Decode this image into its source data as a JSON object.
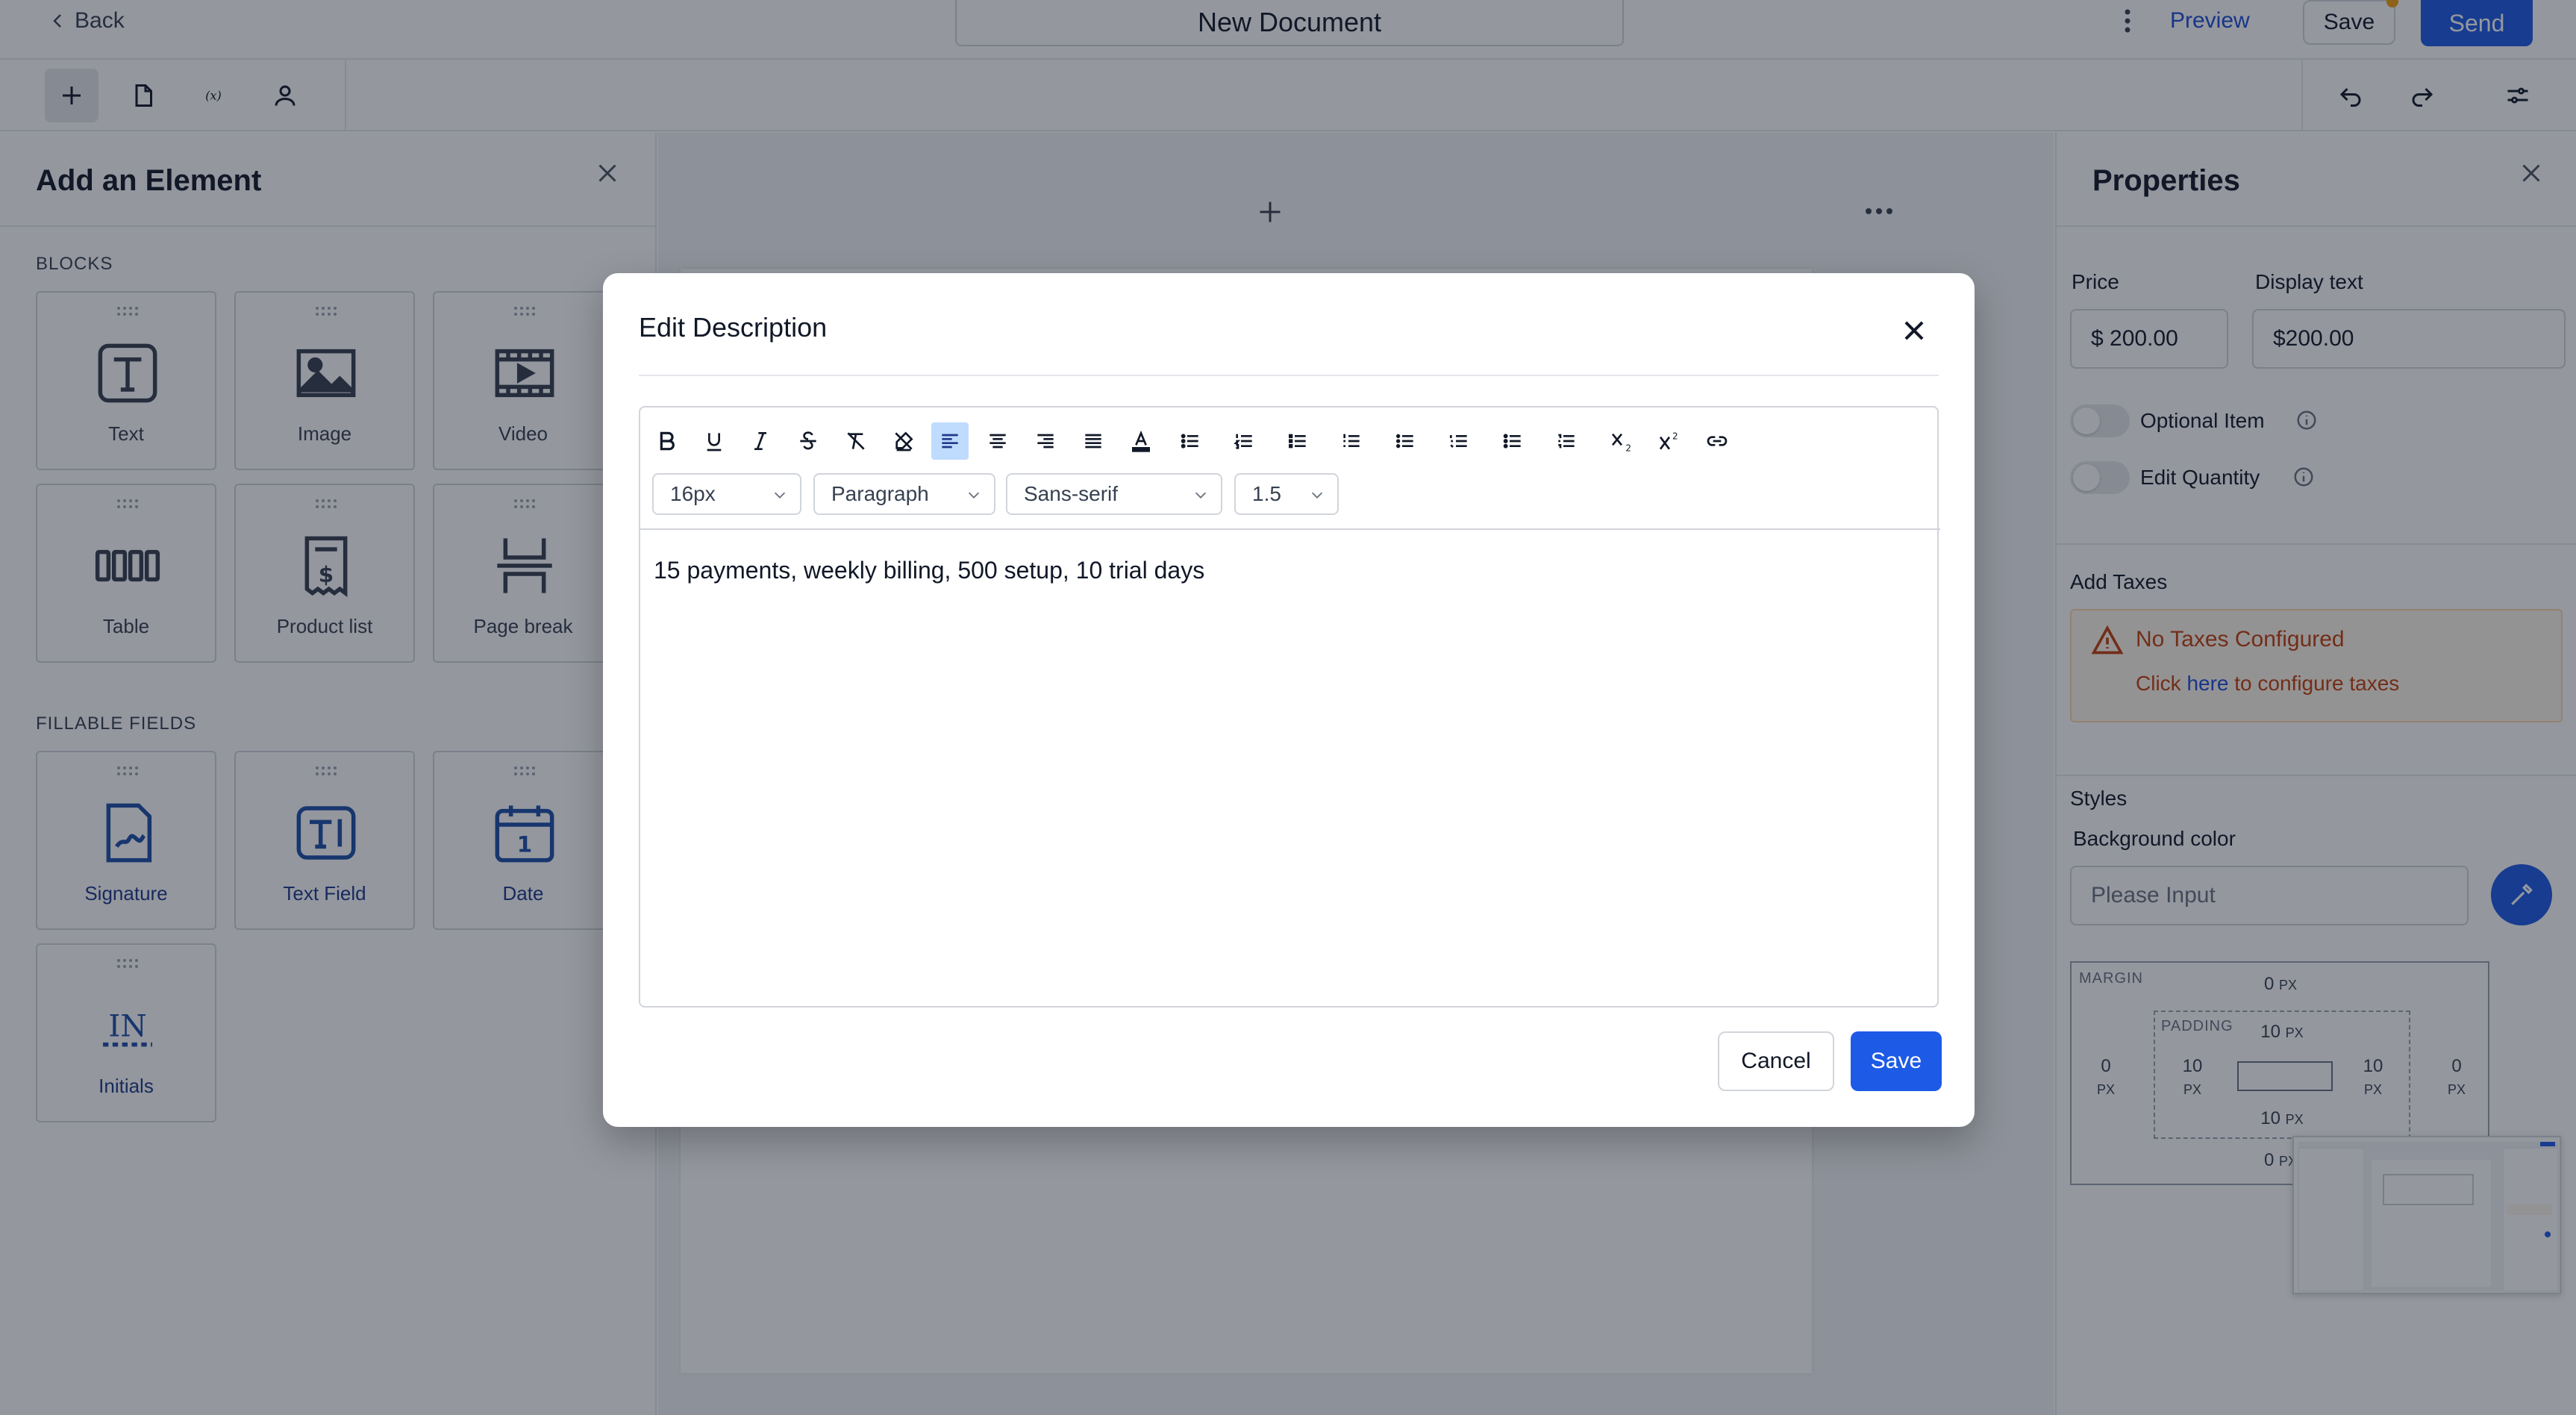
{
  "header": {
    "back_label": "Back",
    "document_title": "New Document",
    "preview_label": "Preview",
    "save_label": "Save",
    "send_label": "Send"
  },
  "left_panel": {
    "title": "Add an Element",
    "blocks_label": "BLOCKS",
    "blocks": [
      {
        "label": "Text",
        "icon": "text-icon"
      },
      {
        "label": "Image",
        "icon": "image-icon"
      },
      {
        "label": "Video",
        "icon": "video-icon"
      },
      {
        "label": "Table",
        "icon": "table-icon"
      },
      {
        "label": "Product list",
        "icon": "product-list-icon"
      },
      {
        "label": "Page break",
        "icon": "page-break-icon"
      }
    ],
    "fillable_label": "FILLABLE FIELDS",
    "fillable": [
      {
        "label": "Signature",
        "icon": "signature-icon"
      },
      {
        "label": "Text Field",
        "icon": "text-field-icon"
      },
      {
        "label": "Date",
        "icon": "date-icon",
        "glyph": "1"
      },
      {
        "label": "Initials",
        "icon": "initials-icon",
        "glyph": "IN"
      }
    ]
  },
  "right_panel": {
    "title": "Properties",
    "price_label": "Price",
    "price_value": "$ 200.00",
    "display_text_label": "Display text",
    "display_text_value": "$200.00",
    "optional_item_label": "Optional Item",
    "edit_quantity_label": "Edit Quantity",
    "add_taxes_label": "Add Taxes",
    "tax_warning_title": "No Taxes Configured",
    "tax_click": "Click ",
    "tax_here": "here",
    "tax_rest": " to configure taxes",
    "styles_label": "Styles",
    "bg_color_label": "Background color",
    "bg_color_placeholder": "Please Input",
    "box_model": {
      "margin_label": "MARGIN",
      "padding_label": "PADDING",
      "margin_top": "0",
      "margin_bottom": "0",
      "margin_left": "0",
      "margin_right": "0",
      "padding_top": "10",
      "padding_bottom": "10",
      "padding_left": "10",
      "padding_right": "10",
      "unit": "PX"
    }
  },
  "modal": {
    "title": "Edit Description",
    "font_size": "16px",
    "block_type": "Paragraph",
    "font_family": "Sans-serif",
    "line_height": "1.5",
    "content": "15 payments, weekly billing, 500 setup, 10 trial days",
    "cancel_label": "Cancel",
    "save_label": "Save"
  },
  "colors": {
    "primary": "#1d5ae6",
    "link": "#1d4ed8",
    "warning_text": "#c2410c",
    "warning_bg": "#fff7ed"
  }
}
